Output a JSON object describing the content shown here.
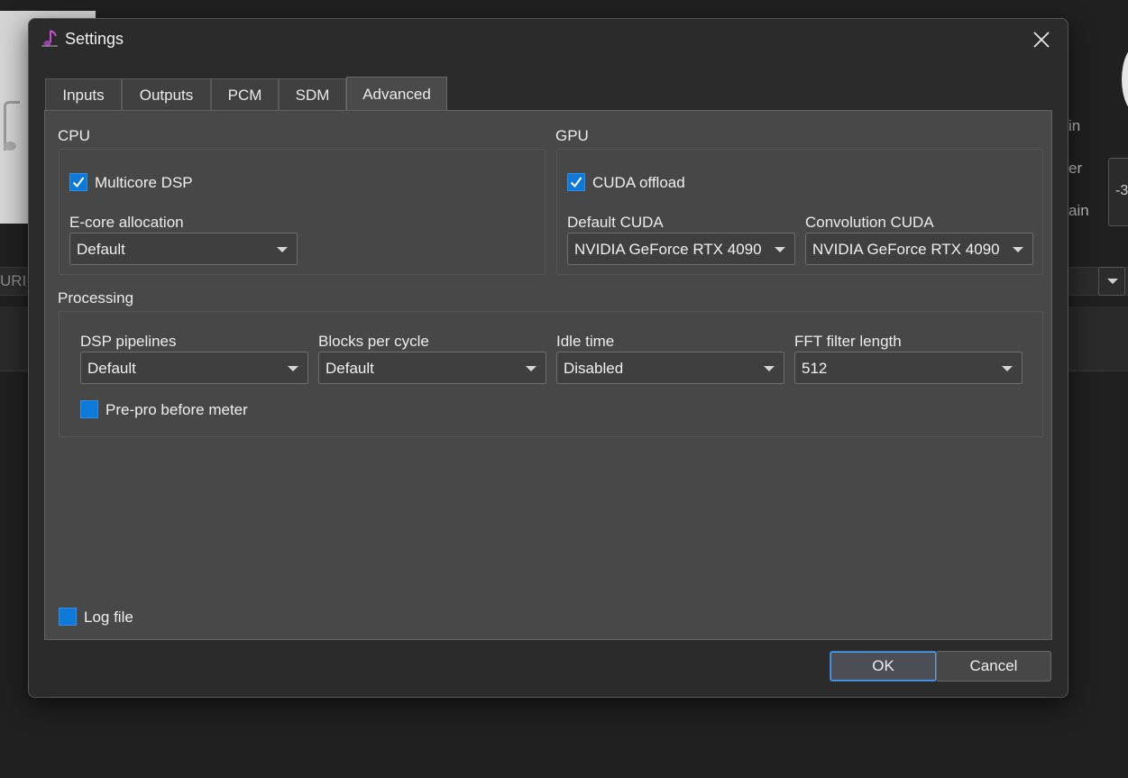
{
  "background": {
    "strip_text": "URI",
    "side_texts": [
      "in",
      "er",
      "ain"
    ],
    "field_value": "-3"
  },
  "dialog": {
    "title": "Settings",
    "close_icon": "close-icon",
    "tabs": [
      {
        "label": "Inputs",
        "active": false
      },
      {
        "label": "Outputs",
        "active": false
      },
      {
        "label": "PCM",
        "active": false
      },
      {
        "label": "SDM",
        "active": false
      },
      {
        "label": "Advanced",
        "active": true
      }
    ],
    "cpu": {
      "heading": "CPU",
      "multicore": {
        "label": "Multicore DSP",
        "checked": true
      },
      "ecore": {
        "label": "E-core allocation",
        "value": "Default"
      }
    },
    "gpu": {
      "heading": "GPU",
      "cuda_offload": {
        "label": "CUDA offload",
        "checked": true
      },
      "default_cuda": {
        "label": "Default CUDA",
        "value": "NVIDIA GeForce RTX 4090"
      },
      "convolution_cuda": {
        "label": "Convolution CUDA",
        "value": "NVIDIA GeForce RTX 4090"
      }
    },
    "processing": {
      "heading": "Processing",
      "dsp_pipelines": {
        "label": "DSP pipelines",
        "value": "Default"
      },
      "blocks_per_cycle": {
        "label": "Blocks per cycle",
        "value": "Default"
      },
      "idle_time": {
        "label": "Idle time",
        "value": "Disabled"
      },
      "fft_filter_length": {
        "label": "FFT filter length",
        "value": "512"
      },
      "prepro": {
        "label": "Pre-pro before meter",
        "checked": false
      }
    },
    "log_file": {
      "label": "Log file",
      "checked": false
    },
    "buttons": {
      "ok": "OK",
      "cancel": "Cancel"
    }
  },
  "colors": {
    "accent": "#0f79d9",
    "dialog_bg": "#2b2b2b",
    "panel_bg": "#484848"
  }
}
